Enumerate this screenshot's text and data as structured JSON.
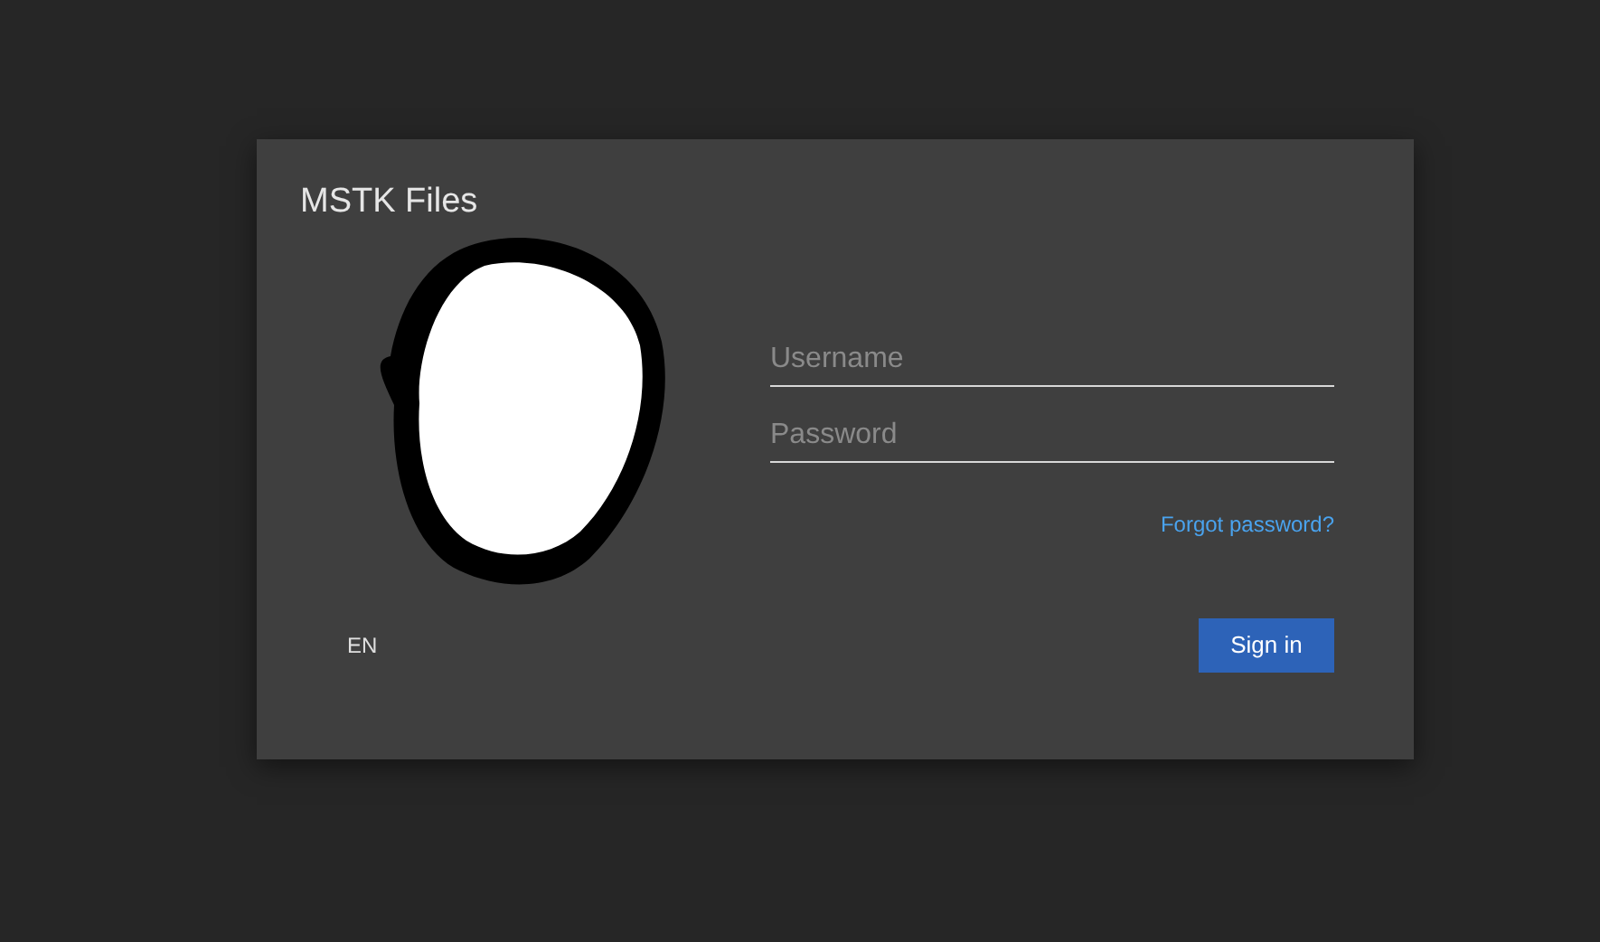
{
  "window": {
    "title": "MSTK Files"
  },
  "fields": [
    {
      "placeholder": "Username"
    },
    {
      "placeholder": "Password"
    }
  ],
  "forgot_link": "Forgot password?",
  "language": "EN",
  "sign_in_button": "Sign in"
}
